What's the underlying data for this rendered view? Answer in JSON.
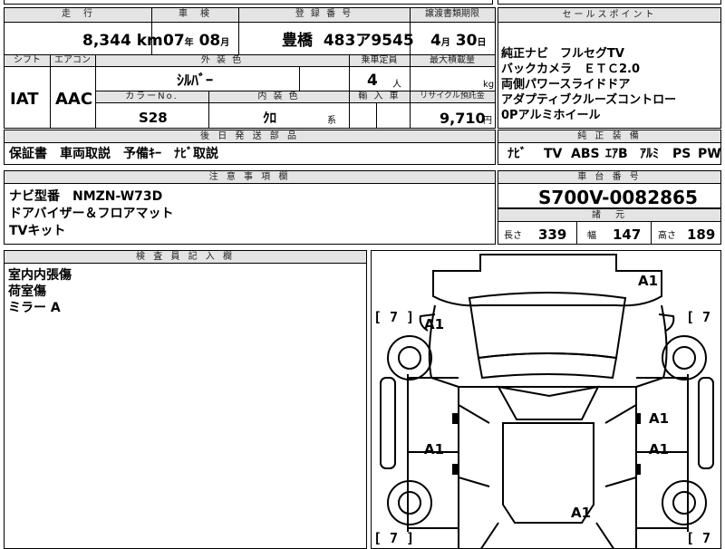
{
  "top_row": {
    "mileage_label": "走　行",
    "mileage_value": "8,344",
    "mileage_unit": "km",
    "shaken_label": "車　検",
    "shaken_year": "07",
    "shaken_year_unit": "年",
    "shaken_month": "08",
    "shaken_month_unit": "月",
    "plate_label": "登 録 番 号",
    "plate_region": "豊橋",
    "plate_number": "483ア9545",
    "transfer_label": "譲渡書類期限",
    "transfer_month": "4",
    "transfer_month_unit": "月",
    "transfer_day": "30",
    "transfer_day_unit": "日"
  },
  "spec_row": {
    "shift_label": "シフト",
    "shift_value": "IAT",
    "aircon_label": "エアコン",
    "aircon_value": "AAC",
    "exterior_label": "外 装 色",
    "exterior_value": "ｼﾙﾊﾞｰ",
    "capacity_label": "乗車定員",
    "capacity_value": "4",
    "capacity_unit": "人",
    "maxload_label": "最大積載量",
    "maxload_unit": "kg",
    "color_no_label": "カラーNo.",
    "color_no_value": "S28",
    "interior_label": "内 装 色",
    "interior_value": "ｸﾛ",
    "interior_suffix": "系",
    "import_label": "輸 入 車",
    "recycle_label": "リサイクル預託金",
    "recycle_value": "9,710",
    "recycle_unit": "円"
  },
  "sales_points": {
    "header": "セールスポイント",
    "lines": [
      "純正ナビ　フルセグTV",
      "バックカメラ　ＥＴＣ2.0",
      "両側パワースライドドア",
      "アダプティブクルーズコントロー",
      "0Pアルミホイール"
    ]
  },
  "later_parts": {
    "header": "後 日 発 送 部 品",
    "text": "保証書　車両取説　予備ｷｰ　ﾅﾋﾞ取説"
  },
  "equipment": {
    "header": "純 正 装 備",
    "items": [
      "ﾅﾋﾞ",
      "TV",
      "ABS",
      "ｴｱB",
      "ｱﾙﾐ",
      "PS",
      "PW"
    ]
  },
  "notes": {
    "header": "注 意 事 項 欄",
    "lines": [
      "ナビ型番　NMZN-W73D",
      "ドアバイザー＆フロアマット",
      "TVキット"
    ]
  },
  "chassis": {
    "header": "車 台 番 号",
    "value": "S700V-0082865"
  },
  "dims": {
    "header": "諸　元",
    "length_label": "長さ",
    "length_value": "339",
    "width_label": "幅",
    "width_value": "147",
    "height_label": "高さ",
    "height_value": "189"
  },
  "inspector": {
    "header": "検 査 員 記 入 欄",
    "lines": [
      "室内内張傷",
      "荷室傷",
      "ミラー A"
    ]
  },
  "diagram": {
    "mark_a1": "A1",
    "mark_7": "[ 7 ]"
  }
}
